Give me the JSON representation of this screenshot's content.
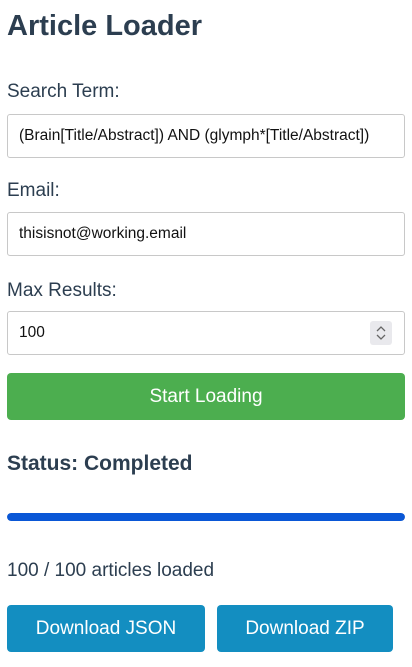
{
  "page": {
    "title": "Article Loader"
  },
  "form": {
    "search_label": "Search Term:",
    "search_value": "(Brain[Title/Abstract]) AND (glymph*[Title/Abstract])",
    "email_label": "Email:",
    "email_value": "thisisnot@working.email",
    "max_label": "Max Results:",
    "max_value": "100",
    "start_label": "Start Loading"
  },
  "status": {
    "text": "Status: Completed",
    "progress": 1.0,
    "count_text": "100 / 100 articles loaded"
  },
  "downloads": {
    "json_label": "Download JSON",
    "zip_label": "Download ZIP"
  },
  "colors": {
    "start_button": "#4cae4f",
    "download_button": "#138ec1",
    "progress_fill": "#0a57d6",
    "text": "#2c3e50"
  }
}
